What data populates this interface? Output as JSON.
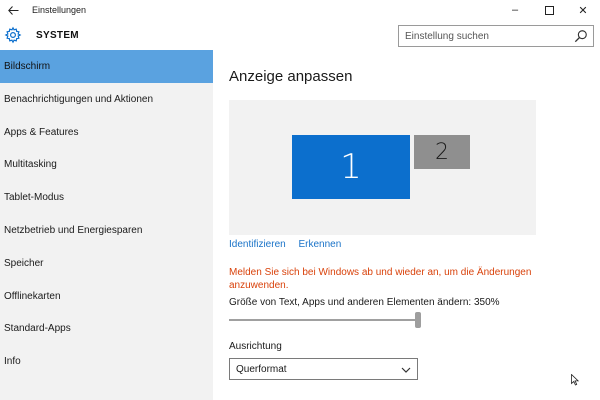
{
  "window": {
    "back_icon": "arrow-left-icon",
    "title": "Einstellungen",
    "controls": {
      "minimize": "–",
      "maximize": "☐",
      "close": "✕"
    }
  },
  "header": {
    "section_icon": "gear-icon",
    "section": "SYSTEM",
    "search": {
      "placeholder": "Einstellung suchen",
      "value": "",
      "icon": "search-icon"
    }
  },
  "sidebar": {
    "items": [
      {
        "label": "Bildschirm",
        "active": true
      },
      {
        "label": "Benachrichtigungen und Aktionen"
      },
      {
        "label": "Apps & Features"
      },
      {
        "label": "Multitasking"
      },
      {
        "label": "Tablet-Modus"
      },
      {
        "label": "Netzbetrieb und Energiesparen"
      },
      {
        "label": "Speicher"
      },
      {
        "label": "Offlinekarten"
      },
      {
        "label": "Standard-Apps"
      },
      {
        "label": "Info"
      }
    ]
  },
  "main": {
    "title": "Anzeige anpassen",
    "monitors": [
      {
        "label": "1",
        "selected": true
      },
      {
        "label": "2",
        "selected": false
      }
    ],
    "links": {
      "identify": "Identifizieren",
      "detect": "Erkennen"
    },
    "warning": "Melden Sie sich bei Windows ab und wieder an, um die Änderungen anzuwenden.",
    "scale_label": "Größe von Text, Apps und anderen Elementen ändern: 350%",
    "scale_slider": {
      "fraction": 1.0
    },
    "orientation": {
      "label": "Ausrichtung",
      "value": "Querformat"
    }
  },
  "colors": {
    "accent": "#0c6fcd",
    "sidebar_active": "#5aa2e0",
    "sidebar_bg": "#f2f2f2",
    "warning": "#d9420b",
    "link": "#1a73c8",
    "monitor_secondary": "#8f8f8f"
  }
}
